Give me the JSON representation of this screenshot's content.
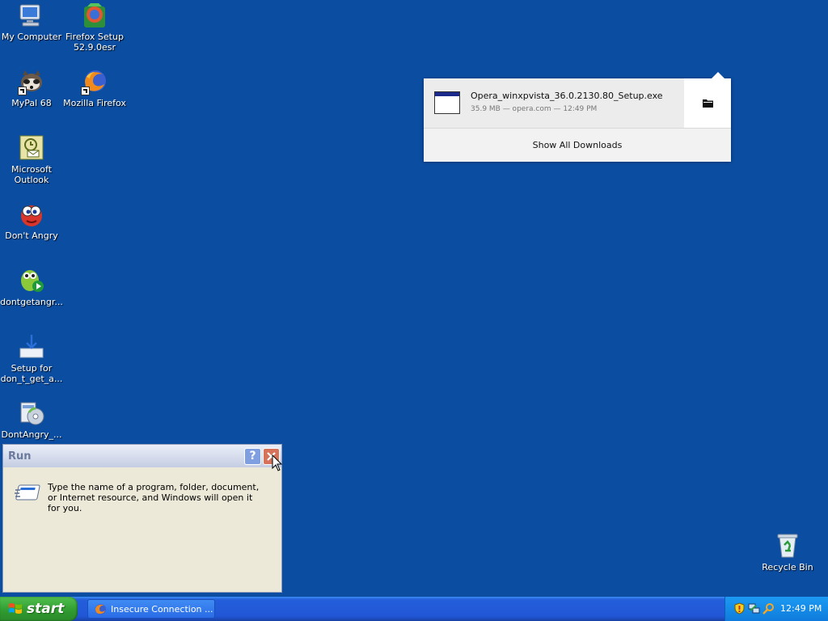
{
  "desktop": {
    "icons": [
      {
        "label": "My Computer"
      },
      {
        "label": "Firefox Setup\n52.9.0esr"
      },
      {
        "label": "MyPal 68"
      },
      {
        "label": "Mozilla Firefox"
      },
      {
        "label": "Microsoft\nOutlook"
      },
      {
        "label": "Don't Angry"
      },
      {
        "label": "dontgetangr..."
      },
      {
        "label": "Setup for\ndon_t_get_a..."
      },
      {
        "label": "DontAngry_..."
      },
      {
        "label": "Recycle Bin"
      }
    ]
  },
  "downloads": {
    "file_name": "Opera_winxpvista_36.0.2130.80_Setup.exe",
    "meta": "35.9 MB — opera.com — 12:49 PM",
    "show_all": "Show All Downloads"
  },
  "run_dialog": {
    "title": "Run",
    "help_label": "?",
    "message": "Type the name of a program, folder, document, or Internet resource, and Windows will open it for you."
  },
  "taskbar": {
    "start_label": "start",
    "task_label": "Insecure Connection ...",
    "clock": "12:49 PM"
  },
  "colors": {
    "desktop": "#0b4da1",
    "taskbar": "#245edb",
    "start": "#2f9a2f",
    "tray": "#0f7bdc"
  }
}
